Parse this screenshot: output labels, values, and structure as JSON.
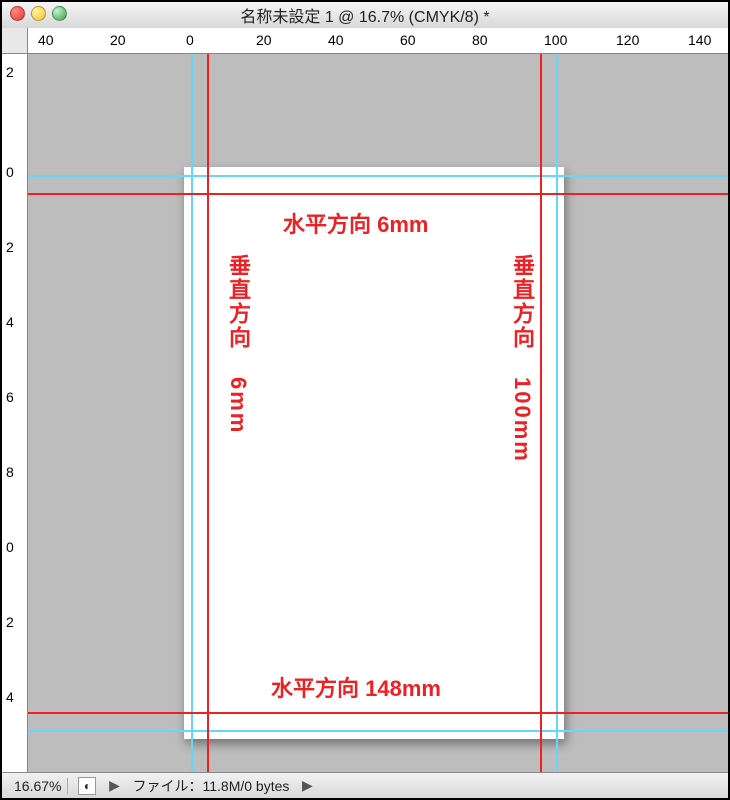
{
  "title": "名称未設定 1 @ 16.7% (CMYK/8) *",
  "ruler_top": [
    "40",
    "20",
    "0",
    "20",
    "40",
    "60",
    "80",
    "100",
    "120",
    "140"
  ],
  "ruler_left": [
    "2",
    "0",
    "2",
    "4",
    "6",
    "8",
    "0",
    "2",
    "4"
  ],
  "labels": {
    "top_h": "水平方向 6mm",
    "left_v_prefix": "垂直方向 ",
    "left_v_value": "6mm",
    "right_v_prefix": "垂直方向 ",
    "right_v_value": "100mm",
    "bottom_h": "水平方向 148mm"
  },
  "status": {
    "zoom": "16.67%",
    "file": "ファイル：11.8M/0 bytes",
    "chev": "▶"
  }
}
